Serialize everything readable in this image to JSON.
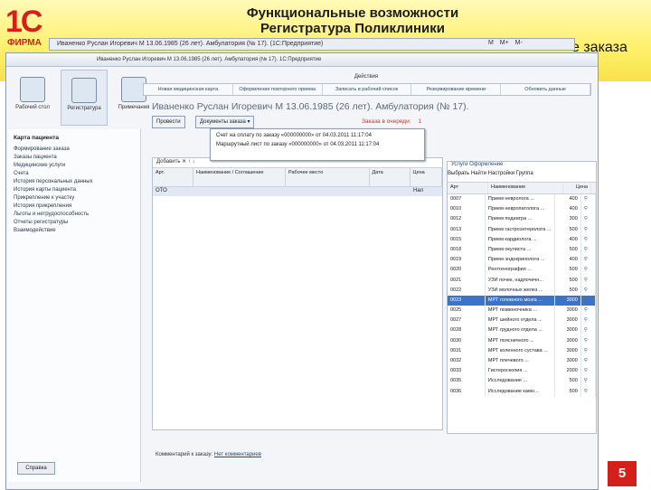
{
  "slide": {
    "title_line1": "Функциональные возможности",
    "title_line2": "Регистратура Поликлиники",
    "title_tail": "е заказа",
    "page_number": "5",
    "logo_text": "1С",
    "logo_firma": "ФИРМА"
  },
  "app": {
    "title": "Иваненко Руслан Игоревич М 13.06.1985 (26 лет). Амбулатория (№ 17). (1С:Предприятие)",
    "buttons": [
      "M",
      "M+",
      "M-"
    ]
  },
  "window": {
    "title": "Иваненко Руслан Игоревич М 13.06.1985 (26 лет). Амбулатория (№ 17). 1С:Предприятие"
  },
  "tools": [
    {
      "label": "Рабочий стол"
    },
    {
      "label": "Регистратура"
    },
    {
      "label": "Примечания"
    }
  ],
  "left_panel": {
    "heading": "Карта пациента",
    "items": [
      "Формирование заказа",
      "Заказы пациента",
      "Медицинские услуги",
      "Счета",
      "История персональных данных",
      "История карты пациента",
      "Прикрепление к участку",
      "История прикрепления",
      "Льготы и нетрудоспособность",
      "Отчеты регистратуры",
      "Взаимодействие"
    ],
    "footer_button": "Справка"
  },
  "actions": {
    "title": "Действия",
    "items": [
      "Новая медицинская карта",
      "Оформление повторного приема",
      "Записать в рабочий список",
      "Резервирование времени",
      "Обновить данные"
    ]
  },
  "patient_header": "Иваненко Руслан Игоревич М 13.06.1985 (26 лет). Амбулатория (№ 17).",
  "buttons": {
    "primary": "Провести",
    "print": "Документы заказа ▾",
    "order_label": "Заказа в очереди:",
    "order_value": "1"
  },
  "dropdown": [
    "Счет на оплату по заказу «000000000» от 04.03.2011 11:17:04",
    "Маршрутный лист по заказу «000000000» от 04.03.2011 11:17:04"
  ],
  "left_table": {
    "toolbar": "Добавить   ✕   ↑   ↓",
    "headers": [
      "Арт.",
      "Наименование / Соглашение",
      "Рабочее место",
      "Дата",
      "Цена"
    ],
    "row": [
      "ОТО",
      "",
      "",
      "",
      "Нал"
    ]
  },
  "right_table": {
    "tabs": "Услуги   Оформление",
    "toolbar": "Выбрать   Найти   Настройки   Группа",
    "headers": [
      "Арт",
      "Наименование",
      "Цена",
      ""
    ],
    "rows": [
      [
        "0007",
        "Прием невролога ...",
        "400"
      ],
      [
        "0010",
        "Прием невропатолога ...",
        "400"
      ],
      [
        "0012",
        "Прием педиатра ...",
        "300"
      ],
      [
        "0013",
        "Прием гастроэнтеролога ...",
        "500"
      ],
      [
        "0015",
        "Прием кардиолога ...",
        "400"
      ],
      [
        "0018",
        "Прием окулиста ...",
        "500"
      ],
      [
        "0019",
        "Прием эндокринолога ...",
        "400"
      ],
      [
        "0020",
        "Рентгенография ...",
        "500"
      ],
      [
        "0021",
        "УЗИ почек, надпочечн...",
        "500"
      ],
      [
        "0022",
        "УЗИ молочных желез ...",
        "500"
      ],
      [
        "0023",
        "МРТ головного мозга ...",
        "3000"
      ],
      [
        "0025",
        "МРТ позвоночника ...",
        "3000"
      ],
      [
        "0027",
        "МРТ шейного отдела ...",
        "3000"
      ],
      [
        "0028",
        "МРТ грудного отдела ...",
        "3000"
      ],
      [
        "0030",
        "МРТ поясничного ...",
        "3000"
      ],
      [
        "0031",
        "МРТ коленного сустава ...",
        "3000"
      ],
      [
        "0032",
        "МРТ плечевого ...",
        "3000"
      ],
      [
        "0033",
        "Гистероскопия ...",
        "2000"
      ],
      [
        "0035",
        "Исследование ...",
        "500"
      ],
      [
        "0036",
        "Исследование камн...",
        "500"
      ]
    ]
  },
  "comment": {
    "label": "Комментарий к заказу:",
    "link": "Нет комментариев"
  }
}
